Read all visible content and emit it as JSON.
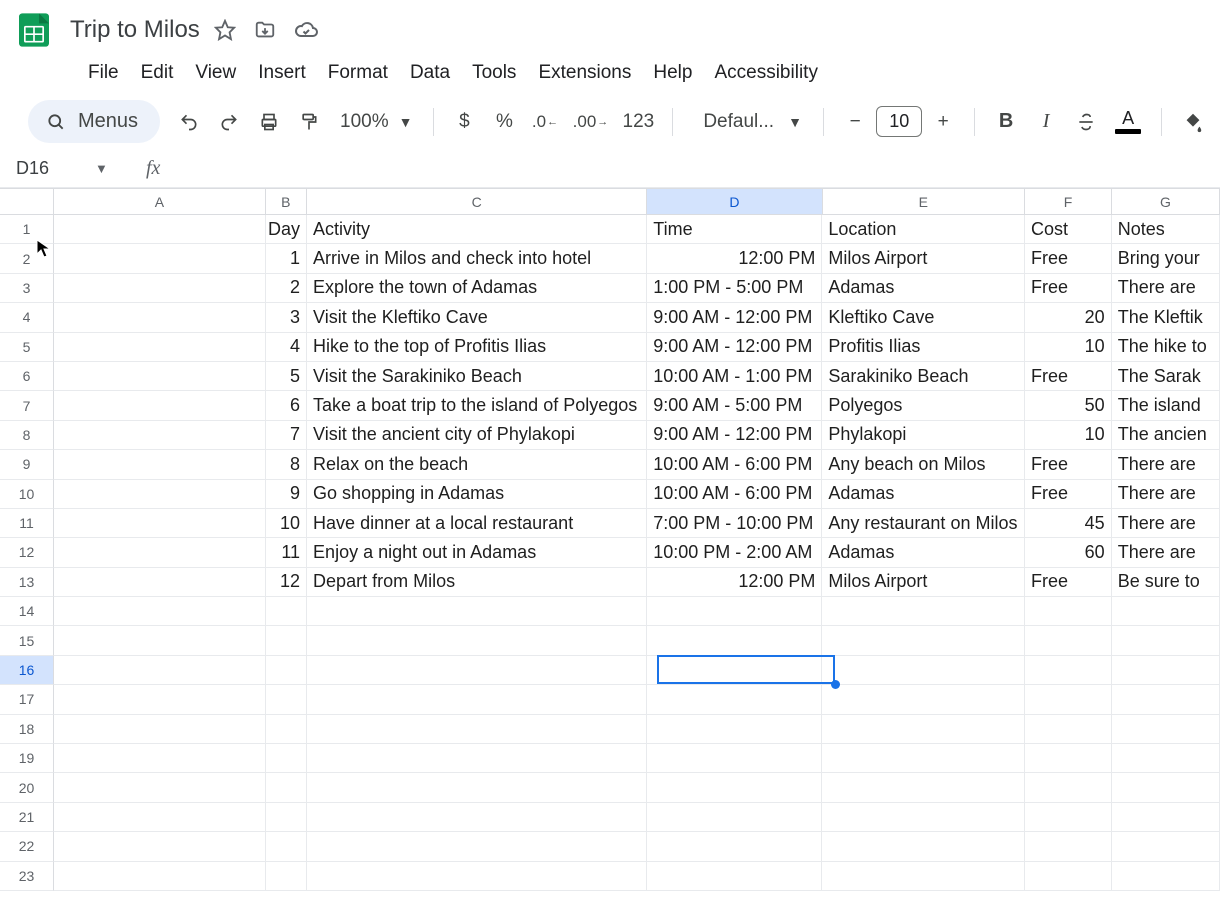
{
  "doc": {
    "title": "Trip to Milos"
  },
  "menus_pill": "Menus",
  "menubar": [
    "File",
    "Edit",
    "View",
    "Insert",
    "Format",
    "Data",
    "Tools",
    "Extensions",
    "Help",
    "Accessibility"
  ],
  "toolbar": {
    "zoom": "100%",
    "currency": "$",
    "percent": "%",
    "dec_dec": ".0",
    "inc_dec": ".00",
    "numfmt": "123",
    "font": "Defaul...",
    "font_size": "10",
    "bold": "B",
    "italic": "I",
    "textcolor": "A",
    "more": "⋮"
  },
  "namebox": "D16",
  "formula": "",
  "columns": [
    "A",
    "B",
    "C",
    "D",
    "E",
    "F",
    "G"
  ],
  "selected": {
    "col": "D",
    "row": 16
  },
  "header_row": {
    "A": "",
    "B": "Day",
    "C": "Activity",
    "D": "Time",
    "E": "Location",
    "F": "Cost",
    "G": "Notes"
  },
  "rows": [
    {
      "B": "1",
      "C": "Arrive in Milos and check into hotel",
      "D": "12:00 PM",
      "E": "Milos Airport",
      "F": "Free",
      "G": "Bring your",
      "Dalign": "right"
    },
    {
      "B": "2",
      "C": "Explore the town of Adamas",
      "D": "1:00 PM - 5:00 PM",
      "E": "Adamas",
      "F": "Free",
      "G": "There are"
    },
    {
      "B": "3",
      "C": "Visit the Kleftiko Cave",
      "D": "9:00 AM - 12:00 PM",
      "E": "Kleftiko Cave",
      "F": "20",
      "Falign": "right",
      "G": "The Kleftik"
    },
    {
      "B": "4",
      "C": "Hike to the top of Profitis Ilias",
      "D": "9:00 AM - 12:00 PM",
      "E": "Profitis Ilias",
      "F": "10",
      "Falign": "right",
      "G": "The hike to"
    },
    {
      "B": "5",
      "C": "Visit the Sarakiniko Beach",
      "D": "10:00 AM - 1:00 PM",
      "E": "Sarakiniko Beach",
      "F": "Free",
      "G": "The Sarak"
    },
    {
      "B": "6",
      "C": "Take a boat trip to the island of Polyegos",
      "D": "9:00 AM - 5:00 PM",
      "E": "Polyegos",
      "F": "50",
      "Falign": "right",
      "G": "The island"
    },
    {
      "B": "7",
      "C": "Visit the ancient city of Phylakopi",
      "D": "9:00 AM - 12:00 PM",
      "E": "Phylakopi",
      "F": "10",
      "Falign": "right",
      "G": "The ancien"
    },
    {
      "B": "8",
      "C": "Relax on the beach",
      "D": "10:00 AM - 6:00 PM",
      "E": "Any beach on Milos",
      "F": "Free",
      "G": "There are"
    },
    {
      "B": "9",
      "C": "Go shopping in Adamas",
      "D": "10:00 AM - 6:00 PM",
      "E": "Adamas",
      "F": "Free",
      "G": "There are"
    },
    {
      "B": "10",
      "C": "Have dinner at a local restaurant",
      "D": "7:00 PM - 10:00 PM",
      "E": "Any restaurant on Milos",
      "F": "45",
      "Falign": "right",
      "G": "There are"
    },
    {
      "B": "11",
      "C": "Enjoy a night out in Adamas",
      "D": "10:00 PM - 2:00 AM",
      "E": "Adamas",
      "F": "60",
      "Falign": "right",
      "G": "There are"
    },
    {
      "B": "12",
      "C": "Depart from Milos",
      "D": "12:00 PM",
      "Dalign": "right",
      "E": "Milos Airport",
      "F": "Free",
      "G": "Be sure to"
    }
  ],
  "total_rows": 23
}
